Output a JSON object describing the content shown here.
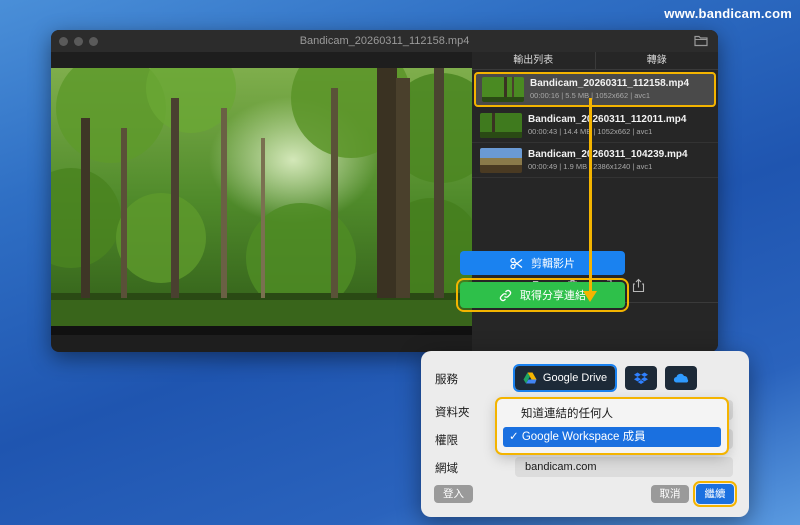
{
  "watermark": "www.bandicam.com",
  "window": {
    "title": "Bandicam_20260311_112158.mp4"
  },
  "panel": {
    "tabs": [
      "輸出列表",
      "轉錄"
    ],
    "files": [
      {
        "name": "Bandicam_20260311_112158.mp4",
        "detail": "00:00:16 | 5.5 MB | 1052x662 | avc1",
        "selected": true
      },
      {
        "name": "Bandicam_20260311_112011.mp4",
        "detail": "00:00:43 | 14.4 MB | 1052x662 | avc1",
        "selected": false
      },
      {
        "name": "Bandicam_20260311_104239.mp4",
        "detail": "00:00:49 | 1.9 MB | 2386x1240 | avc1",
        "selected": false
      }
    ],
    "icons": [
      "folder-icon",
      "trash-icon",
      "import-icon",
      "share-icon"
    ]
  },
  "buttons": {
    "edit": "剪輯影片",
    "share": "取得分享連結"
  },
  "dialog": {
    "service_label": "服務",
    "folder_label": "資料夾",
    "permission_label": "權限",
    "domain_label": "網域",
    "google_drive": "Google Drive",
    "domain_value": "bandicam.com",
    "login": "登入",
    "cancel": "取消",
    "continue": "繼續",
    "permission_options": [
      "知道連結的任何人",
      "Google Workspace 成員"
    ],
    "permission_selected": "Google Workspace 成員"
  },
  "colors": {
    "highlight": "#f4b400",
    "blue": "#1a82f0",
    "green": "#2ec04a"
  }
}
